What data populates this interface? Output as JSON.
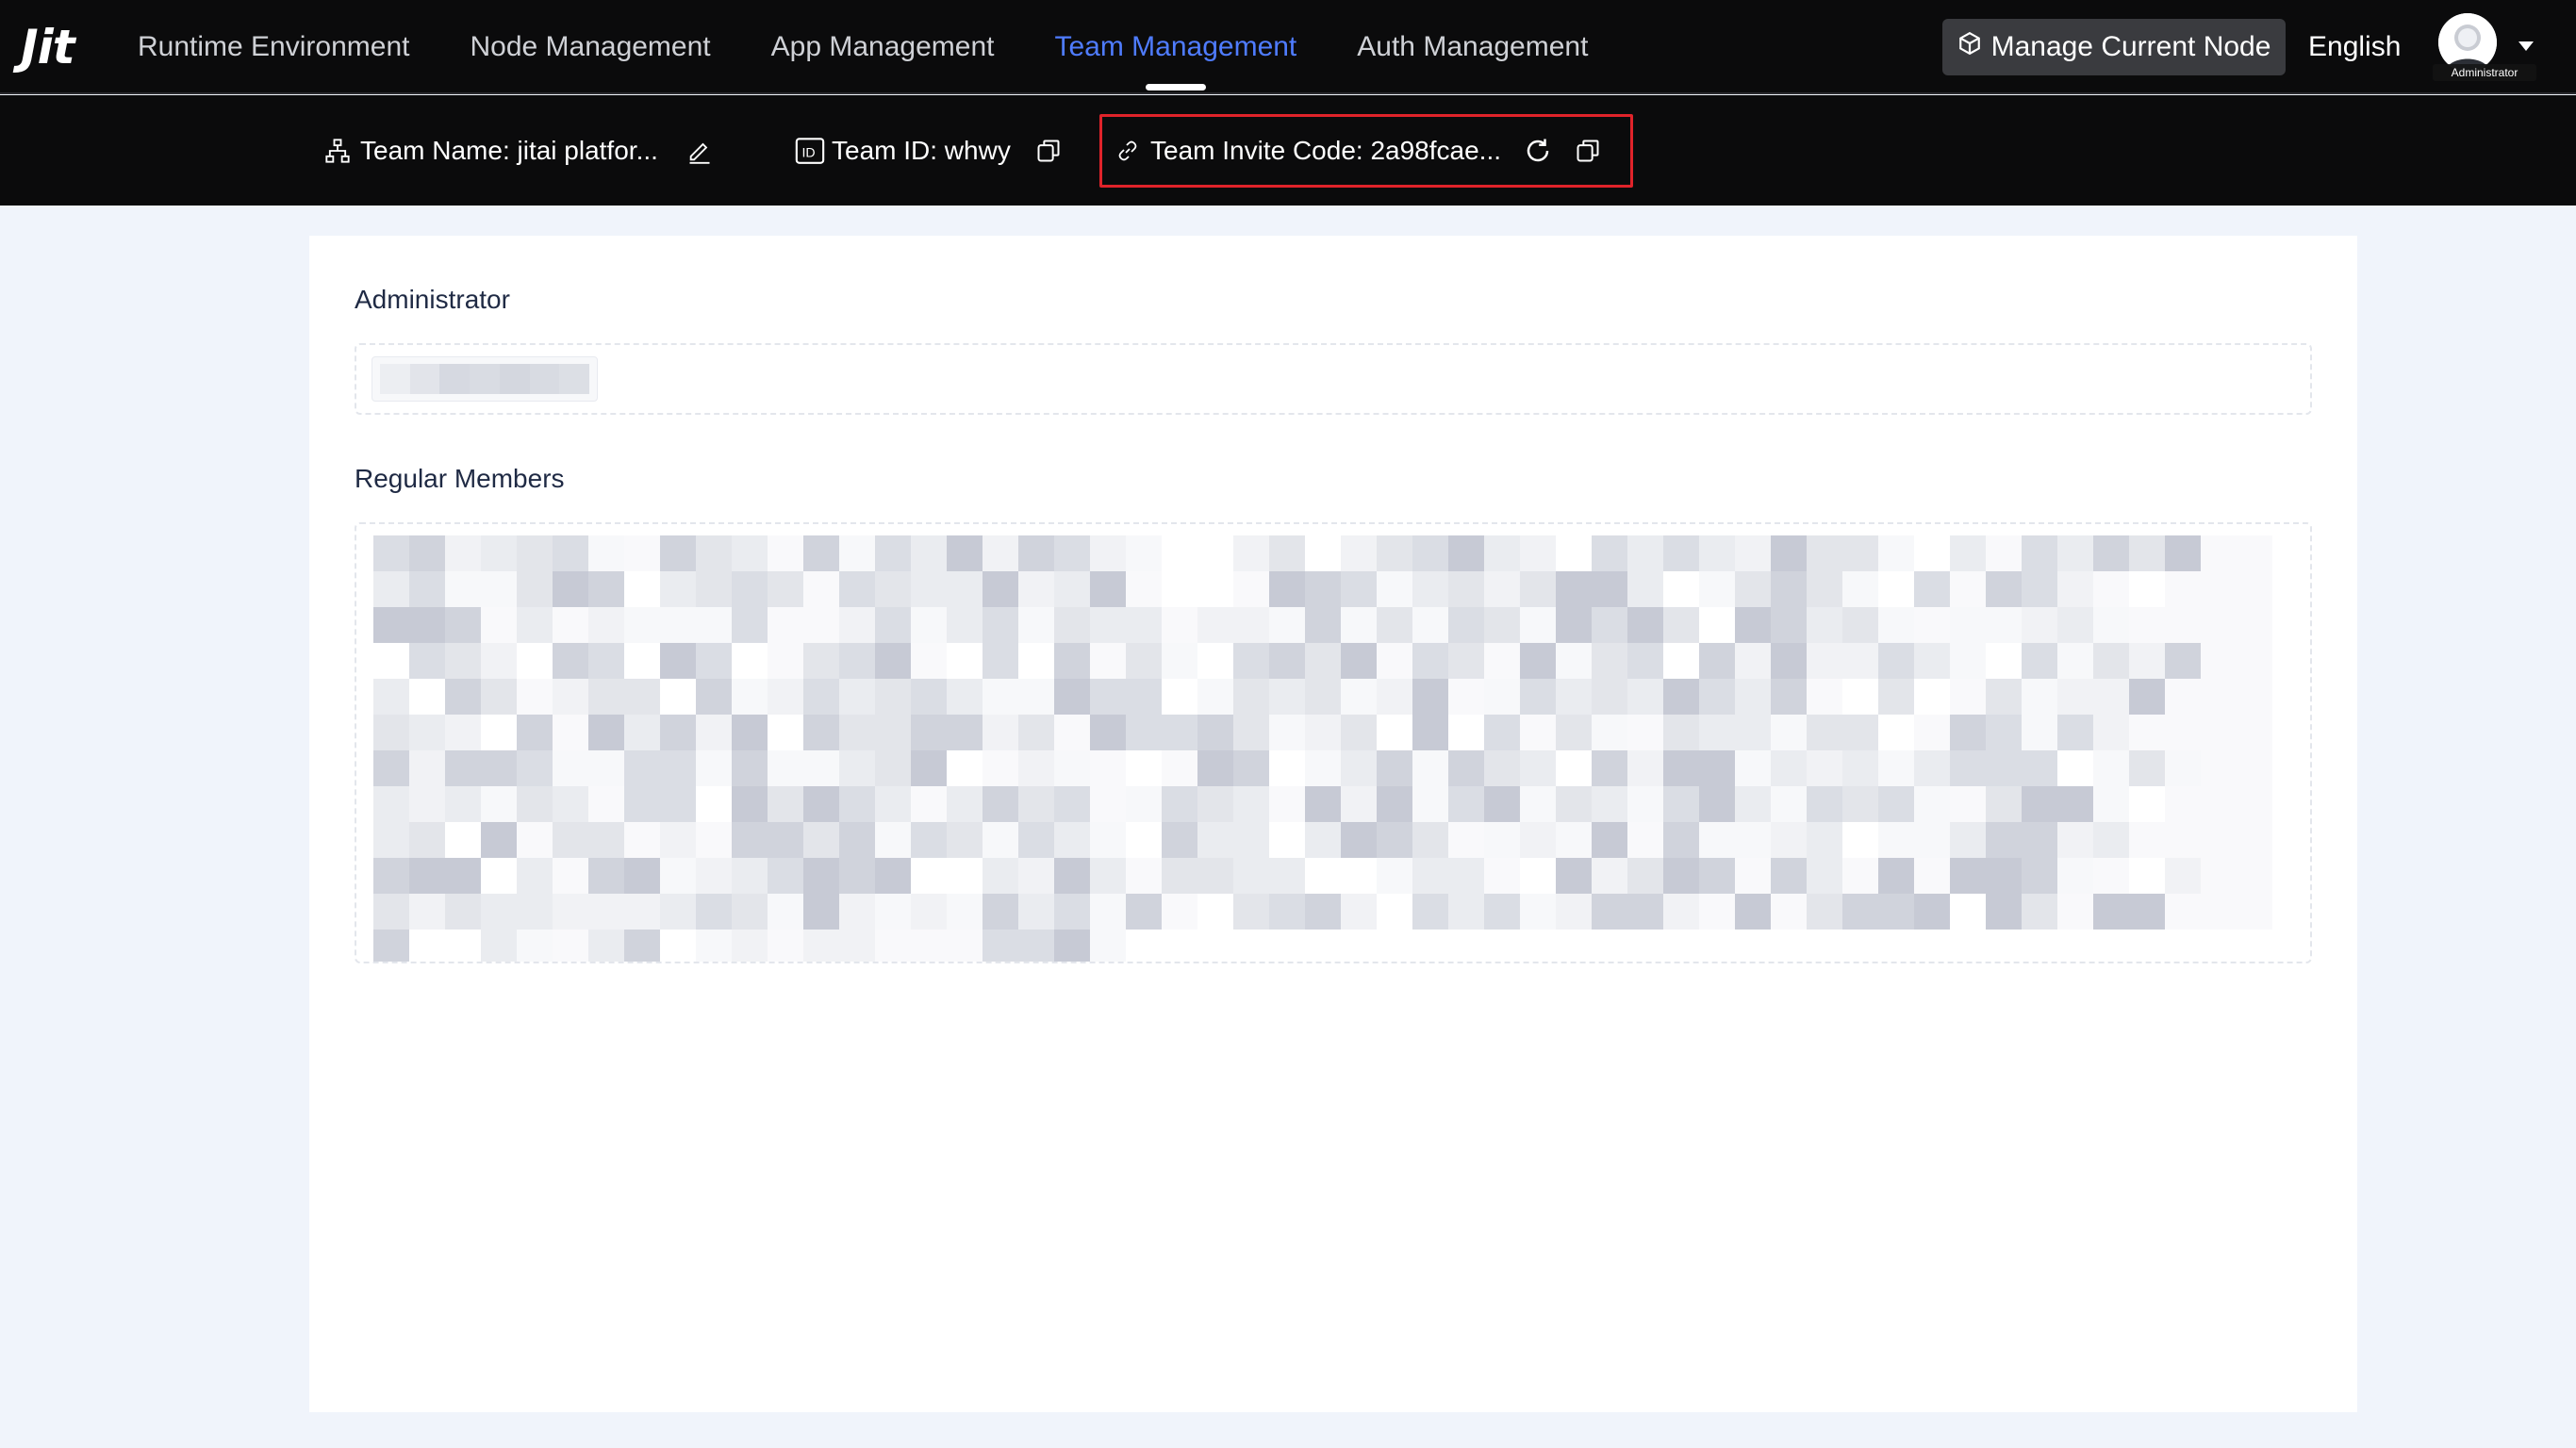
{
  "app": {
    "logo_text": "Jit"
  },
  "nav": {
    "items": [
      {
        "label": "Runtime Environment",
        "active": false
      },
      {
        "label": "Node Management",
        "active": false
      },
      {
        "label": "App Management",
        "active": false
      },
      {
        "label": "Team Management",
        "active": true
      },
      {
        "label": "Auth Management",
        "active": false
      }
    ],
    "manage_node_label": "Manage Current Node",
    "language": "English",
    "avatar_role": "Administrator"
  },
  "subbar": {
    "team_name": "Team Name: jitai platfor...",
    "team_id": "Team ID: whwy",
    "invite_code": "Team Invite Code: 2a98fcae...",
    "icons": {
      "team_name": "org-tree-icon",
      "edit": "edit-pencil-icon",
      "team_id": "id-card-icon",
      "copy": "copy-icon",
      "link": "link-icon",
      "refresh": "refresh-icon"
    }
  },
  "main": {
    "admin_title": "Administrator",
    "members_title": "Regular Members"
  },
  "colors": {
    "accent": "#4f7cff",
    "highlight_border": "#e0232a",
    "nav_bg": "#0b0b0c",
    "page_bg": "#f0f4fb"
  }
}
